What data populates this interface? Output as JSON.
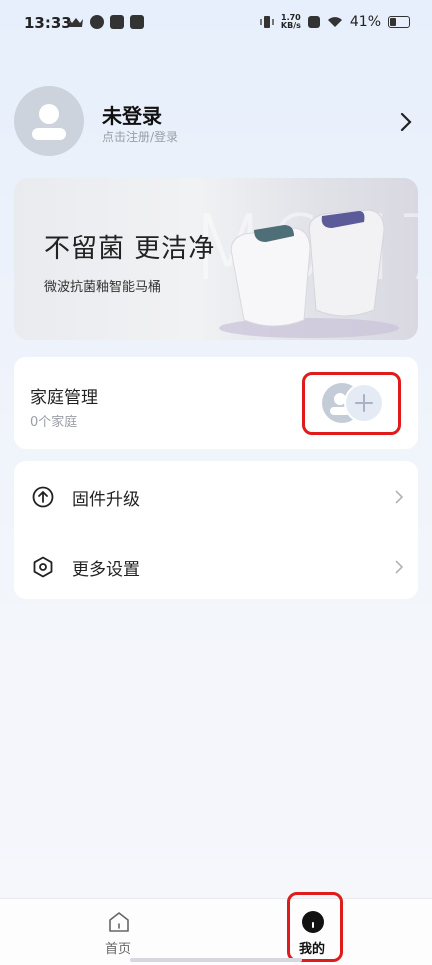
{
  "status_bar": {
    "time": "13:33",
    "speed_value": "1.70",
    "speed_unit": "KB/s",
    "battery": "41%"
  },
  "profile": {
    "name": "未登录",
    "subtitle": "点击注册/登录"
  },
  "banner": {
    "title": "不留菌 更洁净",
    "subtitle": "微波抗菌釉智能马桶",
    "bg_text_1": "M6",
    "bg_text_2": "M7"
  },
  "family": {
    "title": "家庭管理",
    "count": "0个家庭"
  },
  "menu": [
    {
      "label": "固件升级",
      "icon": "arrow-up-circle-icon"
    },
    {
      "label": "更多设置",
      "icon": "hexagon-settings-icon"
    }
  ],
  "bottom_nav": [
    {
      "label": "首页",
      "icon": "home-icon",
      "active": false
    },
    {
      "label": "我的",
      "icon": "profile-dot-icon",
      "active": true
    }
  ],
  "colors": {
    "highlight": "#e01b1b",
    "accent": "#111111"
  }
}
